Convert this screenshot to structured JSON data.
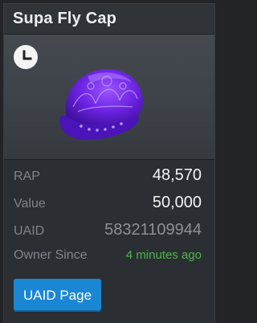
{
  "item": {
    "title": "Supa Fly Cap",
    "status_icon": "clock-icon"
  },
  "details": {
    "rap_label": "RAP",
    "rap_value": "48,570",
    "value_label": "Value",
    "value_value": "50,000",
    "uaid_label": "UAID",
    "uaid_value": "58321109944",
    "owner_since_label": "Owner Since",
    "owner_since_value": "4 minutes ago"
  },
  "actions": {
    "uaid_page_label": "UAID Page"
  },
  "colors": {
    "accent_button": "#1a86d4",
    "owner_since_green": "#4cb848",
    "item_purple": "#7a2cf0"
  }
}
